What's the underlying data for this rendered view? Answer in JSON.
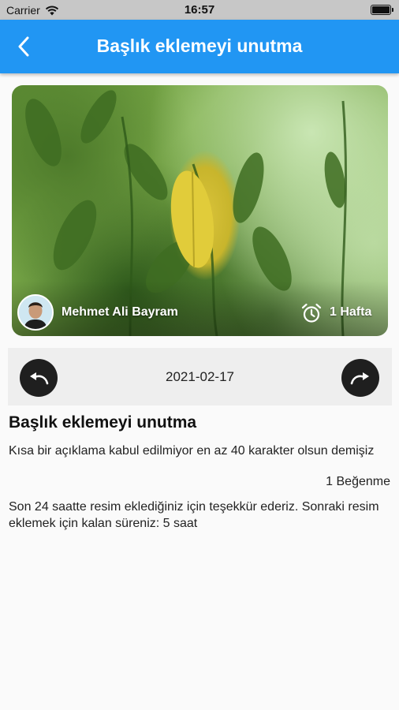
{
  "status_bar": {
    "carrier": "Carrier",
    "time": "16:57",
    "wifi_icon": "wifi-icon",
    "battery_icon": "battery-icon"
  },
  "app_bar": {
    "title": "Başlık eklemeyi unutma",
    "back_icon": "chevron-left-icon",
    "background_color": "#2196f3"
  },
  "photo": {
    "author_name": "Mehmet Ali Bayram",
    "duration": "1 Hafta",
    "alarm_icon": "alarm-clock-icon"
  },
  "date_nav": {
    "date": "2021-02-17",
    "prev_icon": "undo-arrow-icon",
    "next_icon": "redo-arrow-icon"
  },
  "post": {
    "title": "Başlık eklemeyi unutma",
    "description": "Kısa bir açıklama kabul edilmiyor en az 40 karakter olsun demişiz",
    "likes": "1 Beğenme",
    "notice": "Son 24 saatte resim eklediğiniz için teşekkür ederiz. Sonraki resim eklemek için kalan süreniz: 5 saat"
  }
}
